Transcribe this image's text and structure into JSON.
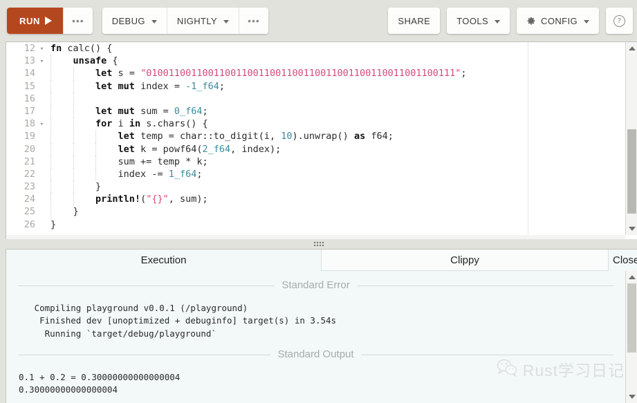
{
  "toolbar": {
    "run_label": "RUN",
    "run_more_label": "•••",
    "debug_label": "DEBUG",
    "channel_label": "NIGHTLY",
    "channel_more_label": "•••",
    "share_label": "SHARE",
    "tools_label": "TOOLS",
    "config_label": "CONFIG",
    "help_label": "?",
    "accent_color": "#b5471f",
    "background_color": "#e2e2dd"
  },
  "editor": {
    "language": "rust",
    "first_line": 12,
    "lines": [
      {
        "num": "12",
        "fold": "▾",
        "indent": 0,
        "tokens": [
          {
            "t": "kw",
            "v": "fn"
          },
          {
            "t": "pun",
            "v": " calc() {"
          }
        ]
      },
      {
        "num": "13",
        "fold": "▾",
        "indent": 1,
        "tokens": [
          {
            "t": "kw",
            "v": "unsafe"
          },
          {
            "t": "pun",
            "v": " {"
          }
        ]
      },
      {
        "num": "14",
        "fold": "",
        "indent": 2,
        "tokens": [
          {
            "t": "kw",
            "v": "let"
          },
          {
            "t": "pun",
            "v": " s = "
          },
          {
            "t": "str",
            "v": "\"0100110011001100110011001100110011001100110011001100111\""
          },
          {
            "t": "pun",
            "v": ";"
          }
        ]
      },
      {
        "num": "15",
        "fold": "",
        "indent": 2,
        "tokens": [
          {
            "t": "kw",
            "v": "let mut"
          },
          {
            "t": "pun",
            "v": " index = "
          },
          {
            "t": "num",
            "v": "-1_f64"
          },
          {
            "t": "pun",
            "v": ";"
          }
        ]
      },
      {
        "num": "16",
        "fold": "",
        "indent": 2,
        "tokens": []
      },
      {
        "num": "17",
        "fold": "",
        "indent": 2,
        "tokens": [
          {
            "t": "kw",
            "v": "let mut"
          },
          {
            "t": "pun",
            "v": " sum = "
          },
          {
            "t": "num",
            "v": "0_f64"
          },
          {
            "t": "pun",
            "v": ";"
          }
        ]
      },
      {
        "num": "18",
        "fold": "▾",
        "indent": 2,
        "tokens": [
          {
            "t": "kw",
            "v": "for"
          },
          {
            "t": "pun",
            "v": " i "
          },
          {
            "t": "kw",
            "v": "in"
          },
          {
            "t": "pun",
            "v": " s.chars() {"
          }
        ]
      },
      {
        "num": "19",
        "fold": "",
        "indent": 3,
        "tokens": [
          {
            "t": "kw",
            "v": "let"
          },
          {
            "t": "pun",
            "v": " temp = char::to_digit(i, "
          },
          {
            "t": "num",
            "v": "10"
          },
          {
            "t": "pun",
            "v": ").unwrap() "
          },
          {
            "t": "kw",
            "v": "as"
          },
          {
            "t": "pun",
            "v": " f64;"
          }
        ]
      },
      {
        "num": "20",
        "fold": "",
        "indent": 3,
        "tokens": [
          {
            "t": "kw",
            "v": "let"
          },
          {
            "t": "pun",
            "v": " k = powf64("
          },
          {
            "t": "num",
            "v": "2_f64"
          },
          {
            "t": "pun",
            "v": ", index);"
          }
        ]
      },
      {
        "num": "21",
        "fold": "",
        "indent": 3,
        "tokens": [
          {
            "t": "pun",
            "v": "sum += temp * k;"
          }
        ]
      },
      {
        "num": "22",
        "fold": "",
        "indent": 3,
        "tokens": [
          {
            "t": "pun",
            "v": "index -= "
          },
          {
            "t": "num",
            "v": "1_f64"
          },
          {
            "t": "pun",
            "v": ";"
          }
        ]
      },
      {
        "num": "23",
        "fold": "",
        "indent": 2,
        "tokens": [
          {
            "t": "pun",
            "v": "}"
          }
        ]
      },
      {
        "num": "24",
        "fold": "",
        "indent": 2,
        "tokens": [
          {
            "t": "kw",
            "v": "println!"
          },
          {
            "t": "pun",
            "v": "("
          },
          {
            "t": "str",
            "v": "\"{}\""
          },
          {
            "t": "pun",
            "v": ", sum);"
          }
        ]
      },
      {
        "num": "25",
        "fold": "",
        "indent": 1,
        "tokens": [
          {
            "t": "pun",
            "v": "}"
          }
        ]
      },
      {
        "num": "26",
        "fold": "",
        "indent": 0,
        "tokens": [
          {
            "t": "pun",
            "v": "}"
          }
        ]
      }
    ]
  },
  "output_panel": {
    "tabs": [
      {
        "label": "Execution",
        "active": true
      },
      {
        "label": "Clippy",
        "active": false
      },
      {
        "label": "Close",
        "active": false
      }
    ],
    "stderr_heading": "Standard Error",
    "stderr_lines": [
      "   Compiling playground v0.0.1 (/playground)",
      "    Finished dev [unoptimized + debuginfo] target(s) in 3.54s",
      "     Running `target/debug/playground`"
    ],
    "stdout_heading": "Standard Output",
    "stdout_lines": [
      "0.1 + 0.2 = 0.30000000000000004",
      "0.30000000000000004"
    ]
  },
  "watermark": {
    "text": "Rust学习日记",
    "icon": "wechat-icon"
  }
}
